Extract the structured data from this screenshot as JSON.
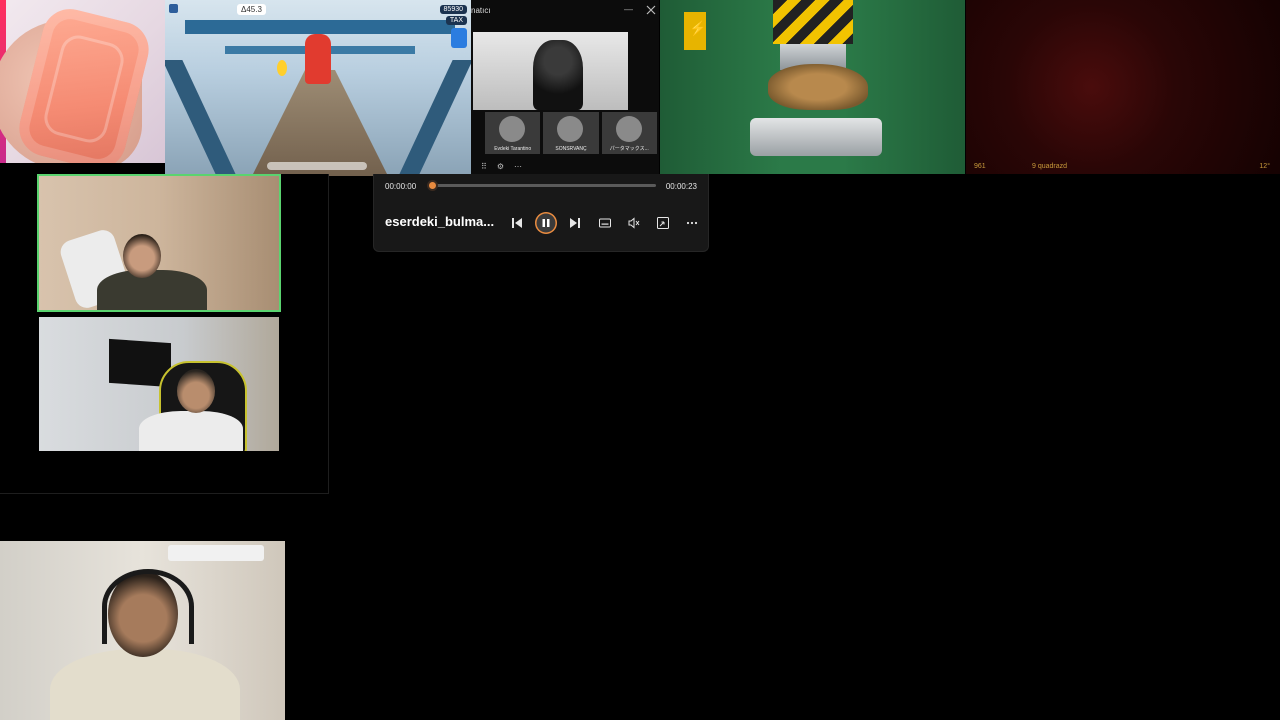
{
  "game_tile": {
    "score": "Δ45.3",
    "coins": "85930",
    "stat": "TAX"
  },
  "meeting_tile": {
    "window_title": "natıcı",
    "participants": [
      "Evdeki Tarantino",
      "SONSRVANÇ",
      "パータマックス..."
    ]
  },
  "dark_tile": {
    "hud_left": "961",
    "hud_mid": "9 quadrazd",
    "hud_right": "12°"
  },
  "player": {
    "current_time": "00:00:00",
    "duration": "00:00:23",
    "filename": "eserdeki_bulma...",
    "progress": 0.0,
    "accent": "#e98b3f"
  }
}
